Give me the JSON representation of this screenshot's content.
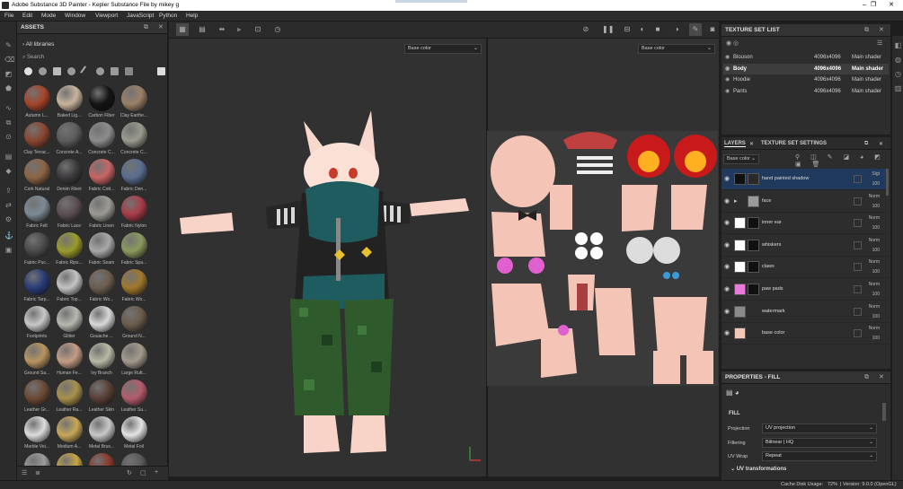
{
  "titlebar": {
    "title": "Adobe Substance 3D Painter - Kepler Substance File by mikey g",
    "minimize": "–",
    "maximize": "❐",
    "close": "✕"
  },
  "menu": [
    "File",
    "Edit",
    "Mode",
    "Window",
    "Viewport",
    "JavaScript",
    "Python",
    "Help"
  ],
  "assets": {
    "title": "ASSETS",
    "library": "All libraries",
    "search_placeholder": "Search",
    "materials": [
      {
        "name": "Autumn L...",
        "color": "#a5452a"
      },
      {
        "name": "Baked Lig...",
        "color": "#c8b49c"
      },
      {
        "name": "Carbon Fiber",
        "color": "#141414"
      },
      {
        "name": "Clay Earthe...",
        "color": "#9a8068"
      },
      {
        "name": "Clay Terrac...",
        "color": "#8a4630"
      },
      {
        "name": "Concrete A...",
        "color": "#5c5c5c"
      },
      {
        "name": "Concrete C...",
        "color": "#8c8c8c"
      },
      {
        "name": "Concrete C...",
        "color": "#9a9a8e"
      },
      {
        "name": "Cork Natural",
        "color": "#8c6444"
      },
      {
        "name": "Denim Rivet",
        "color": "#3c3a3c"
      },
      {
        "name": "Fabric Cott...",
        "color": "#c86464"
      },
      {
        "name": "Fabric Den...",
        "color": "#5a6e90"
      },
      {
        "name": "Fabric Felt",
        "color": "#7c8a94"
      },
      {
        "name": "Fabric Lace",
        "color": "#5c4e54"
      },
      {
        "name": "Fabric Linen",
        "color": "#9c9a94"
      },
      {
        "name": "Fabric Nylon",
        "color": "#a83c48"
      },
      {
        "name": "Fabric Puc...",
        "color": "#4a4a4a"
      },
      {
        "name": "Fabric Rips...",
        "color": "#9a9a2c"
      },
      {
        "name": "Fabric Seam",
        "color": "#a8a8a8"
      },
      {
        "name": "Fabric Spa...",
        "color": "#8a9a5c"
      },
      {
        "name": "Fabric Tarp...",
        "color": "#2a3c78"
      },
      {
        "name": "Fabric Top...",
        "color": "#c4c4c4"
      },
      {
        "name": "Fabric Wo...",
        "color": "#6c5e50"
      },
      {
        "name": "Fabric Wo...",
        "color": "#a0782c"
      },
      {
        "name": "Footprints",
        "color": "#c8c8c8"
      },
      {
        "name": "Glitter",
        "color": "#b8b8b0"
      },
      {
        "name": "Gouache ...",
        "color": "#d8d8d8"
      },
      {
        "name": "Ground N...",
        "color": "#6c5c4c"
      },
      {
        "name": "Ground Sa...",
        "color": "#b89460"
      },
      {
        "name": "Human Fe...",
        "color": "#c49c84"
      },
      {
        "name": "Ivy Branch",
        "color": "#b8b8a4"
      },
      {
        "name": "Large Rutt...",
        "color": "#a49a8c"
      },
      {
        "name": "Leather Gr...",
        "color": "#6c4a34"
      },
      {
        "name": "Leather Ra...",
        "color": "#a8904c"
      },
      {
        "name": "Leather Skin",
        "color": "#5a4036"
      },
      {
        "name": "Leather Su...",
        "color": "#b45c6c"
      },
      {
        "name": "Marble Vei...",
        "color": "#dcdcdc"
      },
      {
        "name": "Medium A...",
        "color": "#c8a858"
      },
      {
        "name": "Metal Brus...",
        "color": "#c8c8c8"
      },
      {
        "name": "Metal Foil",
        "color": "#e4e4e4"
      },
      {
        "name": "",
        "color": "#9c9c9c"
      },
      {
        "name": "",
        "color": "#c8a444"
      },
      {
        "name": "",
        "color": "#8a3a2a"
      },
      {
        "name": "",
        "color": "#5a5a5a"
      }
    ]
  },
  "viewport": {
    "channel_3d": "Base color",
    "channel_2d": "Base color"
  },
  "texture_set_list": {
    "title": "TEXTURE SET LIST",
    "sets": [
      {
        "name": "Blouson",
        "res": "4096x4096",
        "shader": "Main shader"
      },
      {
        "name": "Body",
        "res": "4096x4096",
        "shader": "Main shader"
      },
      {
        "name": "Hoodie",
        "res": "4096x4096",
        "shader": "Main shader"
      },
      {
        "name": "Pants",
        "res": "4096x4096",
        "shader": "Main shader"
      }
    ]
  },
  "layers": {
    "tab_layers": "LAYERS",
    "tab_settings": "TEXTURE SET SETTINGS",
    "channel": "Base color",
    "items": [
      {
        "name": "hand painted shadow",
        "blend": "Slgt",
        "opacity": "100",
        "swatch": "#101010",
        "mask": "#2a2a2a"
      },
      {
        "name": "face",
        "blend": "Norm",
        "opacity": "100",
        "swatch": "#9a9a9a",
        "mask": "#9a9a9a"
      },
      {
        "name": "inner ear",
        "blend": "Norm",
        "opacity": "100",
        "swatch": "#ffffff",
        "mask": "#101010"
      },
      {
        "name": "whiskers",
        "blend": "Norm",
        "opacity": "100",
        "swatch": "#ffffff",
        "mask": "#101010"
      },
      {
        "name": "claws",
        "blend": "Norm",
        "opacity": "100",
        "swatch": "#ffffff",
        "mask": "#101010"
      },
      {
        "name": "paw pads",
        "blend": "Norm",
        "opacity": "100",
        "swatch": "#e87ad8",
        "mask": "#101010"
      },
      {
        "name": "watermark",
        "blend": "Norm",
        "opacity": "100",
        "swatch": "#8a8a8a",
        "mask": ""
      },
      {
        "name": "base color",
        "blend": "Norm",
        "opacity": "100",
        "swatch": "#f4c8b8",
        "mask": ""
      }
    ]
  },
  "properties": {
    "title": "PROPERTIES - FILL",
    "section": "FILL",
    "fields": [
      {
        "label": "Projection",
        "value": "UV projection"
      },
      {
        "label": "Filtering",
        "value": "Bilinear | HQ"
      },
      {
        "label": "UV Wrap",
        "value": "Repeat"
      }
    ],
    "uv_section": "UV transformations"
  },
  "status": {
    "cache": "Cache Disk Usage:",
    "pct": "72%",
    "version": "| Version: 9.0.0 (OpenGL)"
  }
}
